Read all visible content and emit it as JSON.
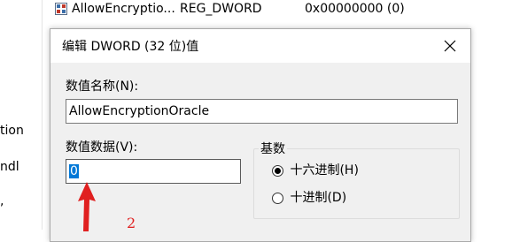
{
  "left_pane": {
    "items": [
      {
        "text": "tion"
      },
      {
        "text": "ndl"
      },
      {
        "text": ","
      }
    ]
  },
  "list_row": {
    "name": "AllowEncryptio...",
    "type": "REG_DWORD",
    "data": "0x00000000 (0)"
  },
  "dialog": {
    "title": "编辑 DWORD (32 位)值",
    "close_icon": "close-icon",
    "value_name_label": "数值名称(N):",
    "value_name": "AllowEncryptionOracle",
    "value_data_label": "数值数据(V):",
    "value_data": "0",
    "base_label": "基数",
    "base_options": [
      {
        "label": "十六进制(H)",
        "checked": true
      },
      {
        "label": "十进制(D)",
        "checked": false
      }
    ]
  },
  "annotation": {
    "number": "2",
    "color": "#e02020"
  },
  "colors": {
    "selection": "#0078d7",
    "dialog_bg": "#f0f0f0"
  }
}
